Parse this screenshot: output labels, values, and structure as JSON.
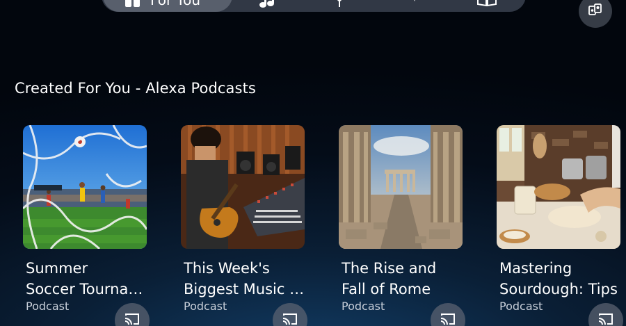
{
  "nav": {
    "items": [
      {
        "label": "For You",
        "icon": "for-you-icon",
        "active": true
      },
      {
        "label": "",
        "icon": "music-note-icon"
      },
      {
        "label": "",
        "icon": "microphone-icon"
      },
      {
        "label": "",
        "icon": "sparkle-icon"
      },
      {
        "label": "",
        "icon": "book-icon"
      }
    ],
    "profile_icon": "profiles-icon"
  },
  "section": {
    "title": "Created For You - Alexa Podcasts"
  },
  "cards": [
    {
      "title_line1": "Summer",
      "title_line2": "Soccer Tournament",
      "subtitle": "Podcast",
      "image": "soccer-match"
    },
    {
      "title_line1": "This Week's",
      "title_line2": "Biggest Music News",
      "subtitle": "Podcast",
      "image": "musician-studio"
    },
    {
      "title_line1": "The Rise and",
      "title_line2": "Fall of Rome",
      "subtitle": "Podcast",
      "image": "roman-ruins"
    },
    {
      "title_line1": "Mastering",
      "title_line2": "Sourdough: Tips",
      "subtitle": "Podcast",
      "image": "sourdough-baking"
    }
  ],
  "colors": {
    "background": "#040c18",
    "accent_glow": "#123d66",
    "text_primary": "#ffffff",
    "text_secondary": "#c9d0da"
  }
}
